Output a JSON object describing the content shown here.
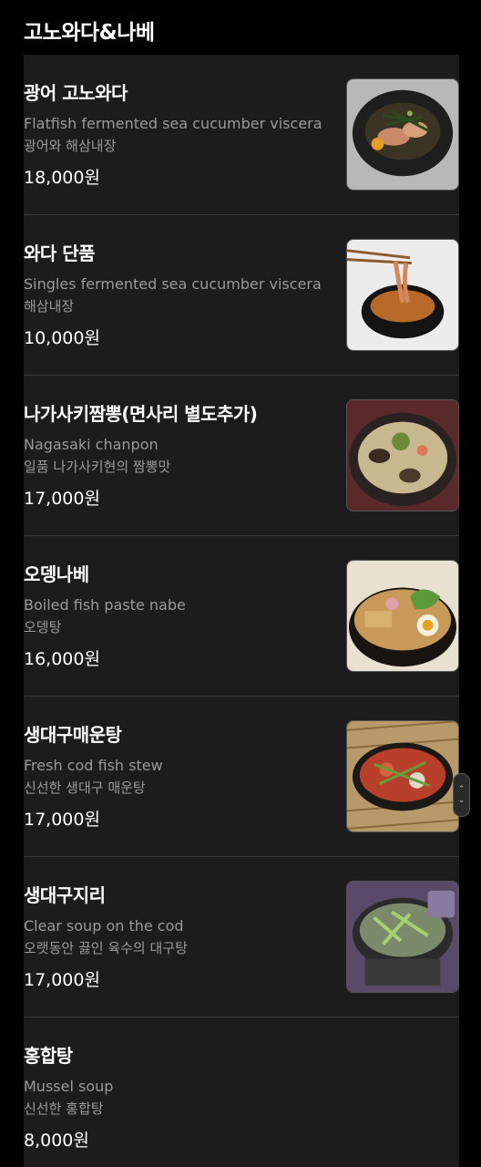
{
  "section": {
    "title": "고노와다&나베"
  },
  "items": [
    {
      "name": "광어 고노와다",
      "desc_en": "Flatfish fermented sea cucumber viscera",
      "desc_ko": "광어와 해삼내장",
      "price": "18,000원",
      "photo": "plated-flatfish-dish"
    },
    {
      "name": "와다 단품",
      "desc_en": "Singles fermented sea cucumber viscera",
      "desc_ko": "해삼내장",
      "price": "10,000원",
      "photo": "chopsticks-bowl"
    },
    {
      "name": "나가사키짬뽕(면사리 별도추가)",
      "desc_en": "Nagasaki chanpon",
      "desc_ko": "일품 나가사키현의 짬뽕맛",
      "price": "17,000원",
      "photo": "chanpon-bowl"
    },
    {
      "name": "오뎅나베",
      "desc_en": "Boiled fish paste nabe",
      "desc_ko": "오뎅탕",
      "price": "16,000원",
      "photo": "oden-bowl"
    },
    {
      "name": "생대구매운탕",
      "desc_en": "Fresh cod fish stew",
      "desc_ko": "신선한 생대구 매운탕",
      "price": "17,000원",
      "photo": "spicy-stew-pot"
    },
    {
      "name": "생대구지리",
      "desc_en": "Clear soup on the cod",
      "desc_ko": "오랫동안 끓인 육수의 대구탕",
      "price": "17,000원",
      "photo": "clear-soup-pot"
    },
    {
      "name": "홍합탕",
      "desc_en": "Mussel soup",
      "desc_ko": "신선한 홍합탕",
      "price": "8,000원",
      "photo": ""
    }
  ],
  "scroll": {
    "up_icon": "chevron-up-icon",
    "down_icon": "chevron-down-icon"
  }
}
